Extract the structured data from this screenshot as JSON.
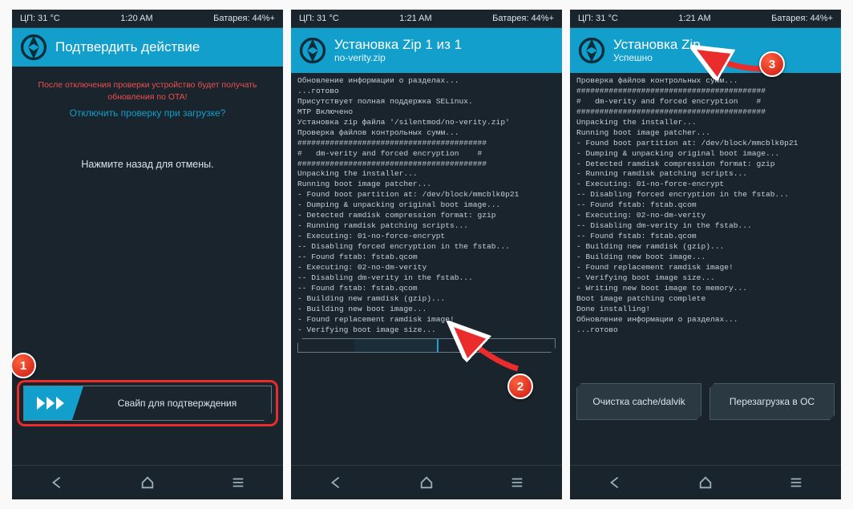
{
  "screens": [
    {
      "status": {
        "left": "ЦП: 31 °C",
        "center": "1:20 AM",
        "right": "Батарея: 44%+"
      },
      "header": {
        "title": "Подтвердить действие"
      },
      "body": {
        "warning": "После отключения проверки устройство будет получать обновления по OTA!",
        "question": "Отключить проверку при загрузке?",
        "hint": "Нажмите назад для отмены."
      },
      "swipe": {
        "label": "Свайп для подтверждения"
      },
      "badge": "1"
    },
    {
      "status": {
        "left": "ЦП: 31 °C",
        "center": "1:21 AM",
        "right": "Батарея: 44%+"
      },
      "header": {
        "title": "Установка Zip 1 из 1",
        "subtitle": "no-verity.zip"
      },
      "terminal": "Обновление информации о разделах...\n...готово\nПрисутствует полная поддержка SELinux.\nMTP Включено\nУстановка zip файла '/silentmod/no-verity.zip'\nПроверка файлов контрольных сумм...\n#########################################\n#   dm-verity and forced encryption    #\n#########################################\nUnpacking the installer...\nRunning boot image patcher...\n- Found boot partition at: /dev/block/mmcblk0p21\n- Dumping & unpacking original boot image...\n- Detected ramdisk compression format: gzip\n- Running ramdisk patching scripts...\n- Executing: 01-no-force-encrypt\n-- Disabling forced encryption in the fstab...\n-- Found fstab: fstab.qcom\n- Executing: 02-no-dm-verity\n-- Disabling dm-verity in the fstab...\n-- Found fstab: fstab.qcom\n- Building new ramdisk (gzip)...\n- Building new boot image...\n- Found replacement ramdisk image!\n- Verifying boot image size...",
      "badge": "2"
    },
    {
      "status": {
        "left": "ЦП: 31 °C",
        "center": "1:21 AM",
        "right": "Батарея: 44%+"
      },
      "header": {
        "title": "Установка Zip",
        "subtitle": "Успешно"
      },
      "terminal": "Проверка файлов контрольных сумм...\n#########################################\n#   dm-verity and forced encryption    #\n#########################################\nUnpacking the installer...\nRunning boot image patcher...\n- Found boot partition at: /dev/block/mmcblk0p21\n- Dumping & unpacking original boot image...\n- Detected ramdisk compression format: gzip\n- Running ramdisk patching scripts...\n- Executing: 01-no-force-encrypt\n-- Disabling forced encryption in the fstab...\n-- Found fstab: fstab.qcom\n- Executing: 02-no-dm-verity\n-- Disabling dm-verity in the fstab...\n-- Found fstab: fstab.qcom\n- Building new ramdisk (gzip)...\n- Building new boot image...\n- Found replacement ramdisk image!\n- Verifying boot image size...\n- Writing new boot image to memory...\nBoot image patching complete\nDone installing!\nОбновление информации о разделах...\n...готово",
      "buttons": {
        "wipe": "Очистка cache/dalvik",
        "reboot": "Перезагрузка в ОС"
      },
      "badge": "3"
    }
  ]
}
